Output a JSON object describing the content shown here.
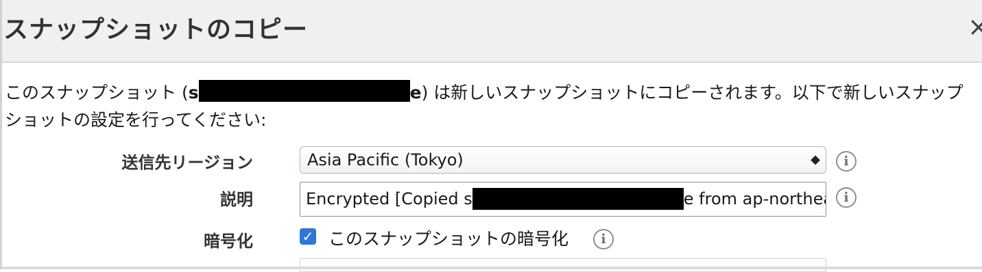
{
  "dialog": {
    "title": "スナップショットのコピー",
    "close_glyph": "×"
  },
  "intro": {
    "prefix": "このスナップショット (",
    "id_start": "s",
    "id_end": "e",
    "suffix": ") は新しいスナップショットにコピーされます。以下で新しいスナップショットの設定を行ってください:"
  },
  "form": {
    "region": {
      "label": "送信先リージョン",
      "value": "Asia Pacific (Tokyo)",
      "arrow_glyph": "◆"
    },
    "description": {
      "label": "説明",
      "value_prefix": "Encrypted [Copied s",
      "value_suffix": "e from ap-northea"
    },
    "encryption": {
      "label": "暗号化",
      "checkbox_label": "このスナップショットの暗号化",
      "checked": true
    },
    "info_glyph": "i"
  },
  "colors": {
    "header_bg": "#f0f0f0",
    "checkbox": "#2f76d8",
    "redaction": "#000000"
  }
}
